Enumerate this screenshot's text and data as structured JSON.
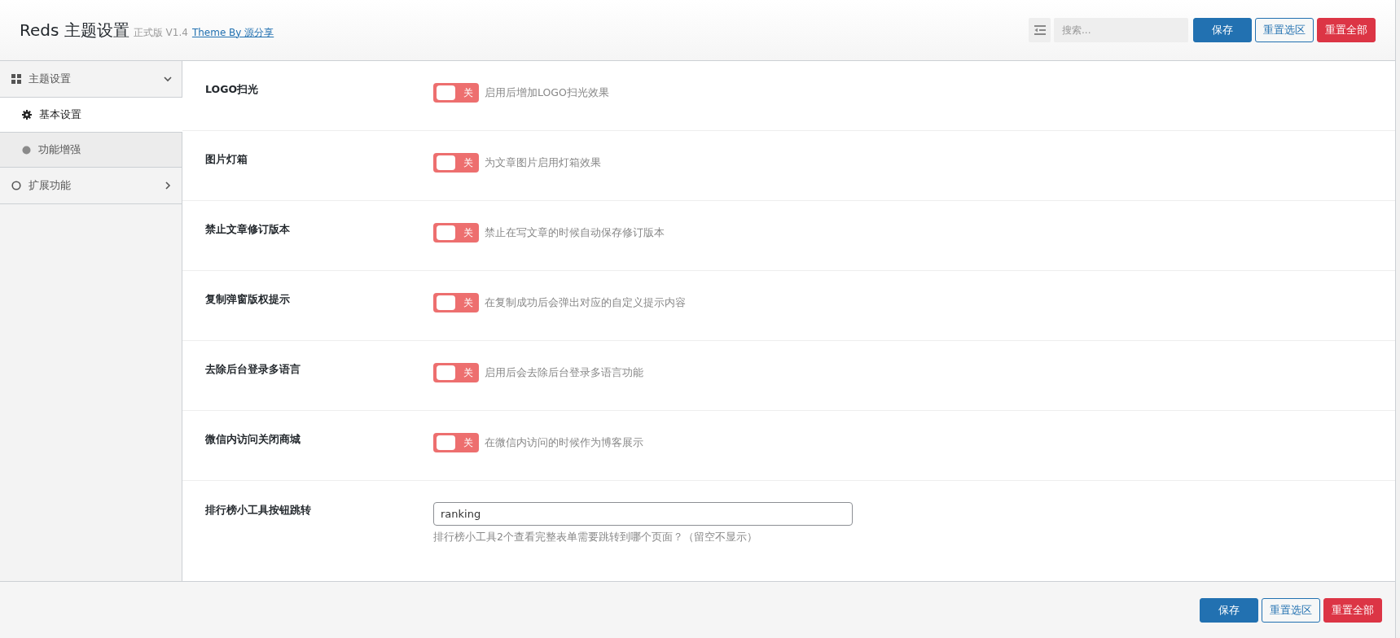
{
  "header": {
    "title": "Reds 主题设置",
    "edition": "正式版 V1.4",
    "credit_link": "Theme By 源分享",
    "search": {
      "placeholder": "搜索..."
    },
    "buttons": [
      {
        "label": "保存",
        "kind": "primary"
      },
      {
        "label": "重置选区",
        "kind": "outline"
      },
      {
        "label": "重置全部",
        "kind": "danger"
      }
    ]
  },
  "sidebar": {
    "items": [
      {
        "label": "主题设置",
        "expanded": true,
        "children": [
          {
            "label": "基本设置",
            "selected": true
          },
          {
            "label": "功能增强",
            "selected": false
          }
        ]
      },
      {
        "label": "扩展功能",
        "expanded": false
      }
    ]
  },
  "fields": [
    {
      "kind": "switch",
      "label": "LOGO扫光",
      "on": false,
      "state_text": "关",
      "description": "启用后增加LOGO扫光效果"
    },
    {
      "kind": "switch",
      "label": "图片灯箱",
      "on": false,
      "state_text": "关",
      "description": "为文章图片启用灯箱效果"
    },
    {
      "kind": "switch",
      "label": "禁止文章修订版本",
      "on": false,
      "state_text": "关",
      "description": "禁止在写文章的时候自动保存修订版本"
    },
    {
      "kind": "switch",
      "label": "复制弹窗版权提示",
      "on": false,
      "state_text": "关",
      "description": "在复制成功后会弹出对应的自定义提示内容"
    },
    {
      "kind": "switch",
      "label": "去除后台登录多语言",
      "on": false,
      "state_text": "关",
      "description": "启用后会去除后台登录多语言功能"
    },
    {
      "kind": "switch",
      "label": "微信内访问关闭商城",
      "on": false,
      "state_text": "关",
      "description": "在微信内访问的时候作为博客展示"
    },
    {
      "kind": "text",
      "label": "排行榜小工具按钮跳转",
      "value": "ranking",
      "description": "排行榜小工具2个查看完整表单需要跳转到哪个页面？（留空不显示）"
    }
  ],
  "footer": {
    "buttons": [
      {
        "label": "保存",
        "kind": "primary"
      },
      {
        "label": "重置选区",
        "kind": "outline"
      },
      {
        "label": "重置全部",
        "kind": "danger"
      }
    ]
  }
}
